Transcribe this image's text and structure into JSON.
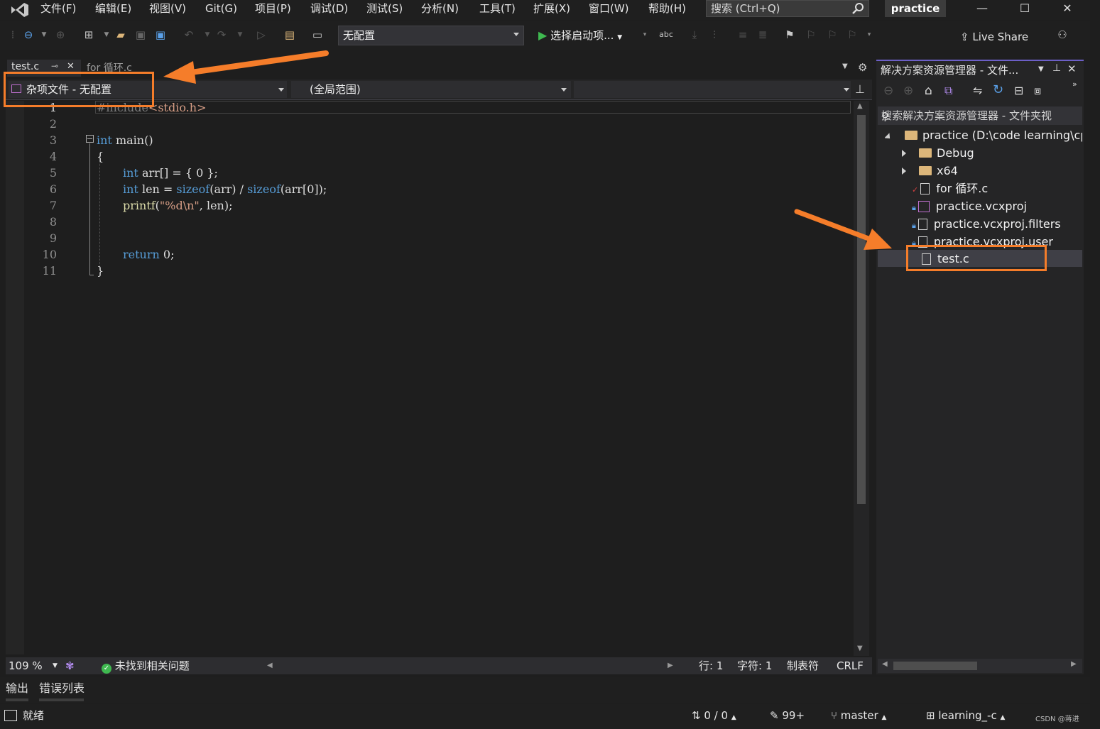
{
  "menu": {
    "items": [
      "文件(F)",
      "编辑(E)",
      "视图(V)",
      "Git(G)",
      "项目(P)",
      "调试(D)",
      "测试(S)",
      "分析(N)",
      "工具(T)",
      "扩展(X)",
      "窗口(W)",
      "帮助(H)"
    ],
    "search_placeholder": "搜索 (Ctrl+Q)",
    "project_name": "practice"
  },
  "toolbar": {
    "configuration": "无配置",
    "start_label": "选择启动项...",
    "live_share": "Live Share"
  },
  "tabs": {
    "active": "test.c",
    "inactive": "for 循环.c"
  },
  "navbar": {
    "project_scope": "杂项文件 - 无配置",
    "scope": "(全局范围)"
  },
  "code": {
    "line_numbers": [
      "1",
      "2",
      "3",
      "4",
      "5",
      "6",
      "7",
      "8",
      "9",
      "10",
      "11"
    ],
    "l1_pp": "#include",
    "l1_header": "<stdio.h>",
    "l3_kw": "int",
    "l3_rest": " main()",
    "l4": "{",
    "l5_kw": "int",
    "l5_rest": " arr[] = { 0 };",
    "l6_kw": "int",
    "l6_a": " len = ",
    "l6_sizeof1": "sizeof",
    "l6_b": "(arr) / ",
    "l6_sizeof2": "sizeof",
    "l6_c": "(arr[0]);",
    "l7_fn": "printf",
    "l7_open": "(",
    "l7_str": "\"%d\\n\"",
    "l7_rest": ", len);",
    "l10_kw": "return",
    "l10_rest": " 0;",
    "l11": "}"
  },
  "editor_status": {
    "zoom": "109 %",
    "issues": "未找到相关问题",
    "line": "行: 1",
    "char": "字符: 1",
    "tab_mode": "制表符",
    "eol": "CRLF"
  },
  "solution_explorer": {
    "title": "解决方案资源管理器 - 文件...",
    "search": "搜索解决方案资源管理器 - 文件夹视",
    "items": [
      {
        "label": "practice (D:\\code learning\\cpp"
      },
      {
        "label": "Debug"
      },
      {
        "label": "x64"
      },
      {
        "label": "for 循环.c"
      },
      {
        "label": "practice.vcxproj"
      },
      {
        "label": "practice.vcxproj.filters"
      },
      {
        "label": "practice.vcxproj.user"
      },
      {
        "label": "test.c"
      }
    ]
  },
  "bottom_panel": {
    "tab_output": "输出",
    "tab_errors": "错误列表"
  },
  "statusbar": {
    "ready": "就绪",
    "sync": "0 / 0",
    "changes": "99+",
    "branch": "master",
    "repo": "learning_-c",
    "watermark": "CSDN @蒋进"
  },
  "colors": {
    "accent_purple": "#6c5fc7",
    "annotation_orange": "#f57d2a",
    "keyword_blue": "#569cd6",
    "string_brown": "#d69d85",
    "function_yellow": "#dcdcaa",
    "success_green": "#3fb950"
  }
}
